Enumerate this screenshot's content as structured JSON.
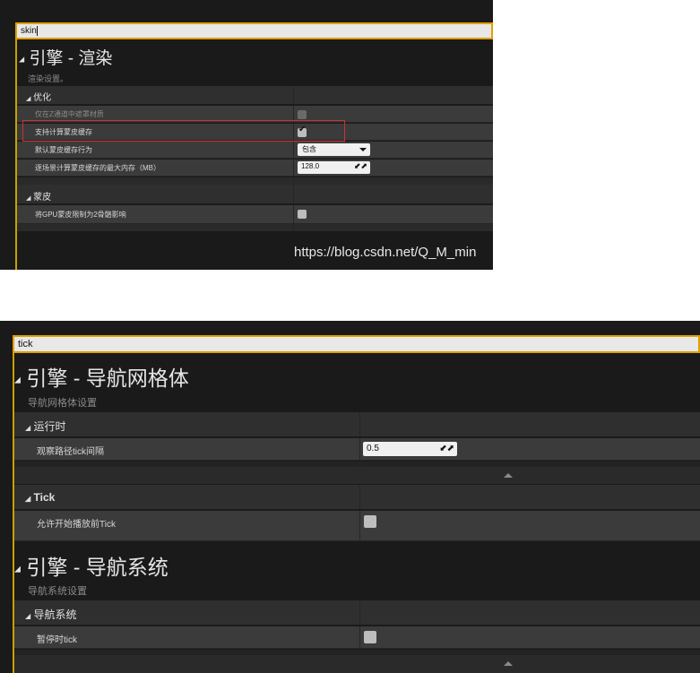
{
  "panel1": {
    "search": {
      "value": "skin"
    },
    "section": {
      "title": "引擎 - 渲染",
      "subtitle": "渲染设置。",
      "categories": [
        {
          "label": "优化",
          "properties": [
            {
              "label": "仅在Z通道中遮罩材质",
              "type": "checkbox",
              "checked": false,
              "disabled": true
            },
            {
              "label": "支持计算蒙皮缓存",
              "type": "checkbox",
              "checked": true,
              "highlighted": true
            },
            {
              "label": "默认蒙皮缓存行为",
              "type": "dropdown",
              "value": "包含"
            },
            {
              "label": "逐场景计算蒙皮缓存的最大内存（MB）",
              "type": "number",
              "value": "128.0"
            }
          ]
        },
        {
          "label": "蒙皮",
          "properties": [
            {
              "label": "将GPU蒙皮限制为2骨骼影响",
              "type": "checkbox",
              "checked": false
            }
          ]
        }
      ]
    },
    "watermark": "https://blog.csdn.net/Q_M_min"
  },
  "panel2": {
    "search": {
      "value": "tick"
    },
    "sections": [
      {
        "title": "引擎 - 导航网格体",
        "subtitle": "导航网格体设置",
        "categories": [
          {
            "label": "运行时",
            "properties": [
              {
                "label": "观察路径tick间隔",
                "type": "number",
                "value": "0.5"
              }
            ]
          },
          {
            "label": "Tick",
            "properties": [
              {
                "label": "允许开始播放前Tick",
                "type": "checkbox",
                "checked": false
              }
            ]
          }
        ]
      },
      {
        "title": "引擎 - 导航系统",
        "subtitle": "导航系统设置",
        "categories": [
          {
            "label": "导航系统",
            "properties": [
              {
                "label": "暂停时tick",
                "type": "checkbox",
                "checked": false
              }
            ]
          }
        ]
      }
    ]
  },
  "icons": {
    "collapse": "triangle-down-icon",
    "expand": "triangle-up-icon",
    "spin": "spin-arrows-icon"
  }
}
